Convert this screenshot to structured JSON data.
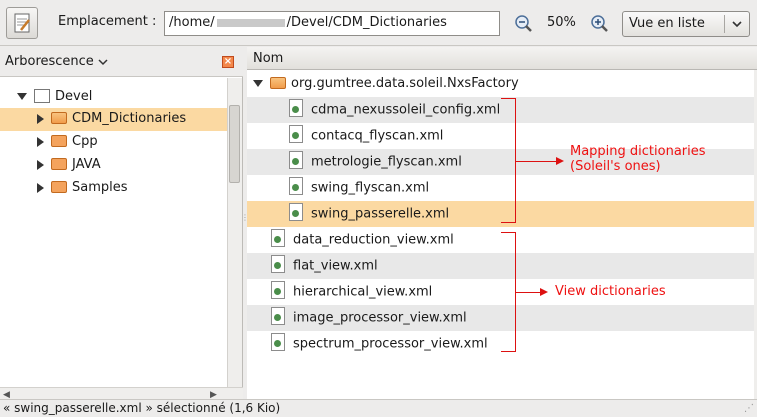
{
  "toolbar": {
    "location_label": "Emplacement :",
    "path_prefix": "/home/",
    "path_suffix": "/Devel/CDM_Dictionaries",
    "zoom": "50%",
    "view_mode": "Vue en liste"
  },
  "sidebar": {
    "title": "Arborescence",
    "root": "Devel",
    "items": [
      {
        "label": "CDM_Dictionaries",
        "selected": true
      },
      {
        "label": "Cpp"
      },
      {
        "label": "JAVA"
      },
      {
        "label": "Samples"
      }
    ]
  },
  "list": {
    "column": "Nom",
    "group_folder": "org.gumtree.data.soleil.NxsFactory",
    "group_files": [
      "cdma_nexussoleil_config.xml",
      "contacq_flyscan.xml",
      "metrologie_flyscan.xml",
      "swing_flyscan.xml",
      "swing_passerelle.xml"
    ],
    "root_files": [
      "data_reduction_view.xml",
      "flat_view.xml",
      "hierarchical_view.xml",
      "image_processor_view.xml",
      "spectrum_processor_view.xml"
    ]
  },
  "annotations": {
    "mapping_line1": "Mapping dictionaries",
    "mapping_line2": "(Soleil's ones)",
    "view": "View dictionaries"
  },
  "status": "« swing_passerelle.xml » sélectionné (1,6 Kio)",
  "colors": {
    "selection": "#fbd9a2",
    "annotation": "#dd1111",
    "folder": "#f4a35d"
  }
}
